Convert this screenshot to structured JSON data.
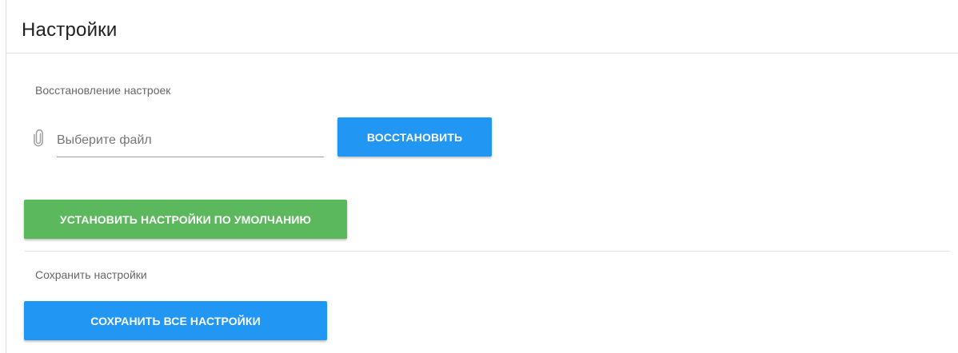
{
  "panel": {
    "title": "Настройки"
  },
  "restore_section": {
    "label": "Восстановление настроек",
    "file_input": {
      "placeholder": "Выберите файл",
      "value": "",
      "icon": "paperclip-icon"
    },
    "restore_button_label": "ВОССТАНОВИТЬ"
  },
  "defaults": {
    "button_label": "УСТАНОВИТЬ НАСТРОЙКИ ПО УМОЛЧАНИЮ"
  },
  "save_section": {
    "label": "Сохранить настройки",
    "save_button_label": "СОХРАНИТЬ ВСЕ НАСТРОЙКИ"
  },
  "colors": {
    "primary_button": "#2196f3",
    "success_button": "#5cb85c",
    "button_text": "#ffffff",
    "muted_text": "#666666",
    "divider": "#e0e0e0"
  }
}
